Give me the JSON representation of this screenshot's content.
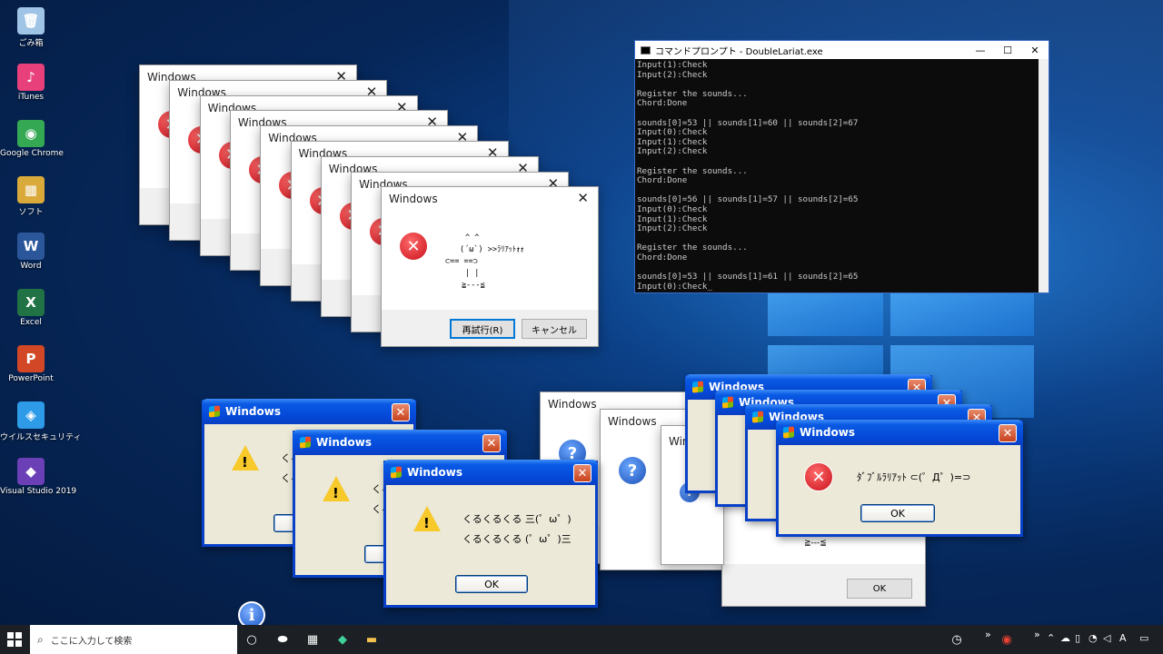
{
  "desktop_icons": [
    {
      "label": "ごみ箱",
      "icon": "recycle-bin-icon",
      "color": "#9fc4e6"
    },
    {
      "label": "iTunes",
      "icon": "itunes-icon",
      "color": "#e8407a"
    },
    {
      "label": "Google Chrome",
      "icon": "chrome-icon",
      "color": "#34a853"
    },
    {
      "label": "ソフト",
      "icon": "folder-icon",
      "color": "#d9a93a"
    },
    {
      "label": "Word",
      "icon": "word-icon",
      "color": "#2b579a"
    },
    {
      "label": "Excel",
      "icon": "excel-icon",
      "color": "#217346"
    },
    {
      "label": "PowerPoint",
      "icon": "powerpoint-icon",
      "color": "#d24726"
    },
    {
      "label": "ウイルスセキュリティ",
      "icon": "antivirus-icon",
      "color": "#2d9be8"
    },
    {
      "label": "Visual Studio 2019",
      "icon": "visual-studio-icon",
      "color": "#6b3fb6"
    }
  ],
  "w10_dialog": {
    "title": "Windows",
    "art_lines": [
      "^  ^",
      "(´ω`)      >>ﾗﾘｱｯﾄｫｫ",
      "⊂==     ==⊃",
      "|    |",
      "≧---≦"
    ],
    "retry_label": "再試行(R)",
    "cancel_label": "キャンセル"
  },
  "w10_stack_title": "Windows",
  "question_dialog_title": "Windows",
  "question_dialog_ok": "OK",
  "question_dialog_tail": "≧---≦",
  "question_dialog_partial_title": "Win",
  "xp_warning": {
    "title": "Windows",
    "line1": "くるくるくる 三(゜ω゜)",
    "line2": "くるくるくる (゜ω゜)三",
    "ok": "OK",
    "partial1": "くる",
    "partial2": "くる"
  },
  "xp_error": {
    "title": "Windows",
    "message": "ﾀﾞﾌﾞﾙﾗﾘｱｯﾄ ⊂(゜Д゜)=⊃",
    "ok": "OK"
  },
  "console": {
    "title": "コマンドプロンプト - DoubleLariat.exe",
    "lines": [
      "Input(1):Check",
      "Input(2):Check",
      "",
      "Register the sounds...",
      "Chord:Done",
      "",
      "sounds[0]=53 || sounds[1]=60 || sounds[2]=67",
      "Input(0):Check",
      "Input(1):Check",
      "Input(2):Check",
      "",
      "Register the sounds...",
      "Chord:Done",
      "",
      "sounds[0]=56 || sounds[1]=57 || sounds[2]=65",
      "Input(0):Check",
      "Input(1):Check",
      "Input(2):Check",
      "",
      "Register the sounds...",
      "Chord:Done",
      "",
      "sounds[0]=53 || sounds[1]=61 || sounds[2]=65",
      "Input(0):Check_"
    ]
  },
  "taskbar": {
    "search_placeholder": "ここに入力して検索",
    "ime": "A"
  }
}
